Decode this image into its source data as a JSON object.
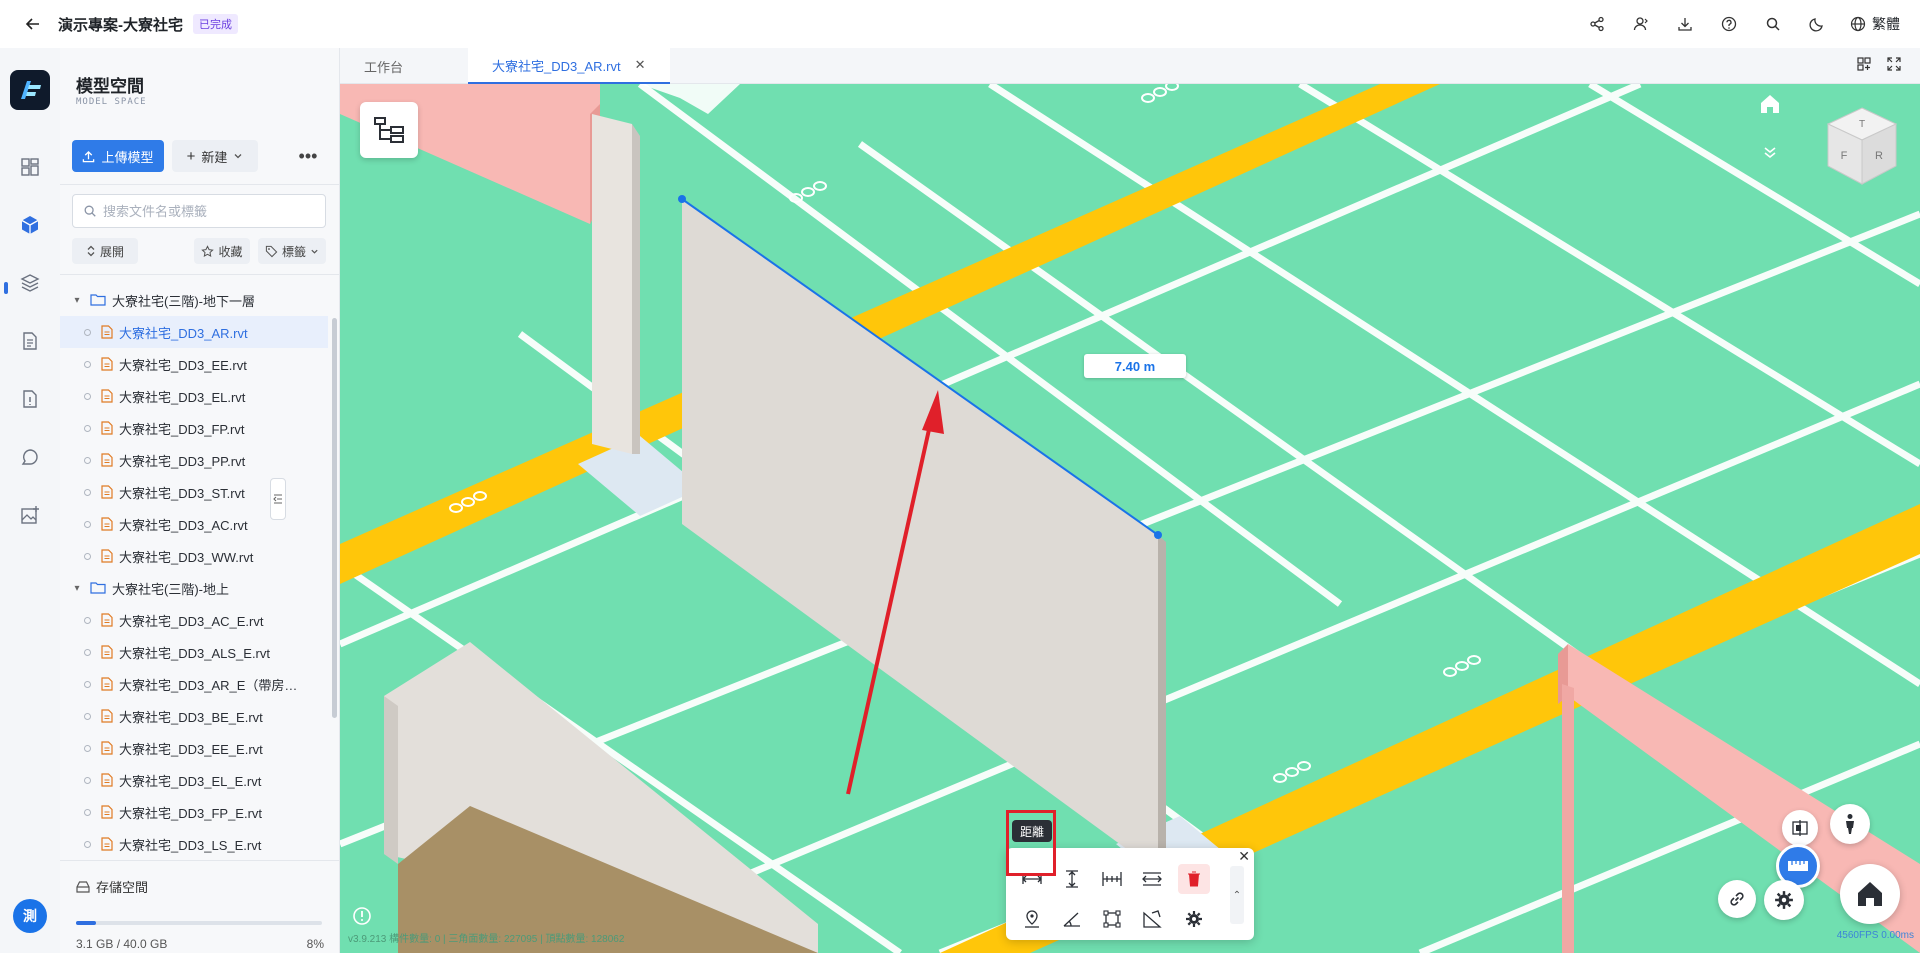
{
  "topbar": {
    "title": "演示專案-大寮社宅",
    "status": "已完成",
    "language": "繁體",
    "icons": [
      "share-icon",
      "members-icon",
      "download-icon",
      "help-icon",
      "search-icon",
      "dark-mode-icon",
      "globe-icon"
    ]
  },
  "rail": {
    "items": [
      "dashboard-icon",
      "model-icon",
      "layers-icon",
      "document-icon",
      "report-icon",
      "chat-icon",
      "image-add-icon"
    ],
    "avatar": "測"
  },
  "panel": {
    "title": "模型空間",
    "subtitle": "MODEL SPACE",
    "upload_label": "上傳模型",
    "new_label": "新建",
    "search_placeholder": "搜索文件名或標籤",
    "filters": {
      "expand": "展開",
      "favorite": "收藏",
      "tags": "標籤"
    },
    "tree": [
      {
        "type": "folder",
        "label": "大寮社宅(三階)-地下一層"
      },
      {
        "type": "file",
        "label": "大寮社宅_DD3_AR.rvt",
        "selected": true
      },
      {
        "type": "file",
        "label": "大寮社宅_DD3_EE.rvt"
      },
      {
        "type": "file",
        "label": "大寮社宅_DD3_EL.rvt"
      },
      {
        "type": "file",
        "label": "大寮社宅_DD3_FP.rvt"
      },
      {
        "type": "file",
        "label": "大寮社宅_DD3_PP.rvt"
      },
      {
        "type": "file",
        "label": "大寮社宅_DD3_ST.rvt"
      },
      {
        "type": "file",
        "label": "大寮社宅_DD3_AC.rvt"
      },
      {
        "type": "file",
        "label": "大寮社宅_DD3_WW.rvt"
      },
      {
        "type": "folder",
        "label": "大寮社宅(三階)-地上"
      },
      {
        "type": "file",
        "label": "大寮社宅_DD3_AC_E.rvt"
      },
      {
        "type": "file",
        "label": "大寮社宅_DD3_ALS_E.rvt"
      },
      {
        "type": "file",
        "label": "大寮社宅_DD3_AR_E（帶房…"
      },
      {
        "type": "file",
        "label": "大寮社宅_DD3_BE_E.rvt"
      },
      {
        "type": "file",
        "label": "大寮社宅_DD3_EE_E.rvt"
      },
      {
        "type": "file",
        "label": "大寮社宅_DD3_EL_E.rvt"
      },
      {
        "type": "file",
        "label": "大寮社宅_DD3_FP_E.rvt"
      },
      {
        "type": "file",
        "label": "大寮社宅_DD3_LS_E.rvt"
      }
    ],
    "storage": {
      "label": "存儲空間",
      "used": "3.1 GB / 40.0 GB",
      "percent_text": "8%",
      "fraction": 0.08
    }
  },
  "tabs": [
    {
      "label": "工作台",
      "active": false
    },
    {
      "label": "大寮社宅_DD3_AR.rvt",
      "active": true
    }
  ],
  "viewport": {
    "measurement": "7.40 m",
    "tooltip": "距離",
    "stats": "v3.9.213   構件數量: 0 | 三角面數量: 227095 | 頂點數量: 128062",
    "fps": "4560FPS 0.00ms",
    "colors": {
      "ground": "#70dfb0",
      "wall": "#dedad5",
      "beam": "#f8b8b4",
      "road": "#ffc60a",
      "measure": "#1a73e8",
      "highlight": "#e0202a"
    }
  },
  "measure_toolbar": {
    "row1": [
      "distance-icon",
      "height-icon",
      "horizontal-dimension-icon",
      "clearance-icon",
      "trash-icon"
    ],
    "row2": [
      "coordinate-pin-icon",
      "angle-icon",
      "area-icon",
      "slope-icon",
      "settings-icon"
    ]
  }
}
